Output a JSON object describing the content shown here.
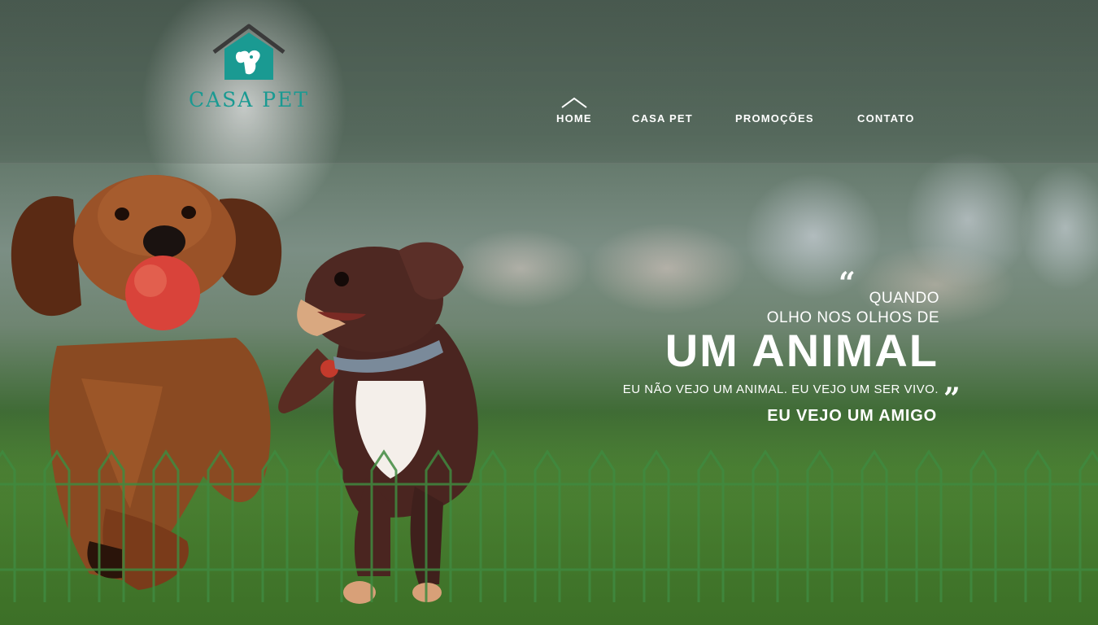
{
  "brand": {
    "name": "CASA PET",
    "primary_color": "#1a9a92",
    "roof_color": "#3a3a3a"
  },
  "nav": {
    "items": [
      {
        "label": "HOME",
        "active": true
      },
      {
        "label": "CASA PET",
        "active": false
      },
      {
        "label": "PROMOÇÕES",
        "active": false
      },
      {
        "label": "CONTATO",
        "active": false
      }
    ],
    "active_indicator_icon": "caret-up-icon"
  },
  "hero": {
    "quote_open": "“",
    "line1": "QUANDO",
    "line2": "OLHO NOS OLHOS DE",
    "headline": "UM ANIMAL",
    "subline": "EU NÃO VEJO UM ANIMAL. EU VEJO UM SER VIVO.",
    "quote_close": "”",
    "closing": "EU VEJO UM AMIGO",
    "text_color": "#ffffff"
  },
  "decor": {
    "fence_color": "#3f8a3f",
    "fence_icon": "picket-fence"
  }
}
